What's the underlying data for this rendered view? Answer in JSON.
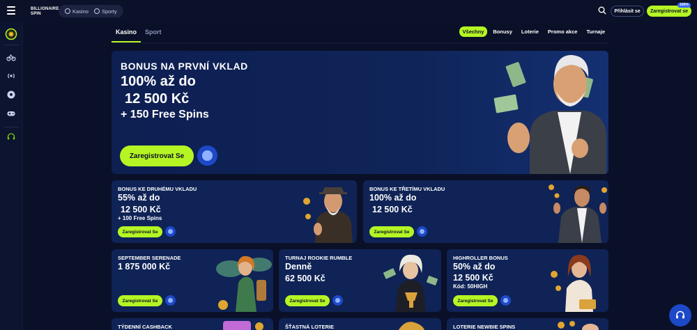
{
  "header": {
    "logo_text_1": "BILLIONAIRE",
    "logo_text_2": "SPIN",
    "segment": [
      {
        "label": "Kasino",
        "icon": "slot-icon"
      },
      {
        "label": "Sporty",
        "icon": "ball-icon"
      }
    ],
    "login_label": "Přihlásit se",
    "register_label": "Zaregistrovat se",
    "badge": "100%"
  },
  "sidebar": {
    "items": [
      "casino-wheel-icon",
      "bike-icon",
      "live-icon",
      "soccer-ball-icon",
      "gamepad-icon",
      "support-agent-icon"
    ]
  },
  "tabs": [
    {
      "label": "Kasino",
      "active": true
    },
    {
      "label": "Sport",
      "active": false
    }
  ],
  "filters": [
    {
      "label": "Všechny",
      "active": true
    },
    {
      "label": "Bonusy",
      "active": false
    },
    {
      "label": "Loterie",
      "active": false
    },
    {
      "label": "Promo akce",
      "active": false
    },
    {
      "label": "Turnaje",
      "active": false
    }
  ],
  "hero": {
    "kicker": "BONUS NA PRVNÍ VKLAD",
    "line1": "100% až do",
    "line2": "12 500 Kč",
    "line3": "+ 150 Free Spins",
    "cta": "Zaregistrovat Se"
  },
  "cards": [
    {
      "kicker": "BONUS KE DRUHÉMU VKLADU",
      "a": "55% až do",
      "b": "12 500 Kč",
      "c": "+ 100 Free Spins",
      "cta": "Zaregistrovat Se"
    },
    {
      "kicker": "BONUS KE TŘETÍMU VKLADU",
      "a": "100% až do",
      "b": "12 500 Kč",
      "c": "",
      "cta": "Zaregistrovat Se"
    },
    {
      "kicker": "SEPTEMBER SERENADE",
      "a": "1 875 000 Kč",
      "b": "",
      "c": "",
      "cta": "Zaregistrovat Se"
    },
    {
      "kicker": "TURNAJ ROOKIE RUMBLE",
      "a": "Denně",
      "b": "62 500 Kč",
      "c": "",
      "cta": "Zaregistrovat Se"
    },
    {
      "kicker": "HIGHROLLER BONUS",
      "a": "50% až do",
      "b": "12 500 Kč",
      "c": "Kód: 50HIGH",
      "cta": "Zaregistrovat Se"
    },
    {
      "kicker": "TÝDENNÍ CASHBACK"
    },
    {
      "kicker": "ŠŤASTNÁ LOTERIE"
    },
    {
      "kicker": "LOTERIE NEWBIE SPINS"
    }
  ],
  "colors": {
    "accent": "#b5f524",
    "background": "#0a1027",
    "card": "#0f2356",
    "info": "#1d49c8"
  }
}
